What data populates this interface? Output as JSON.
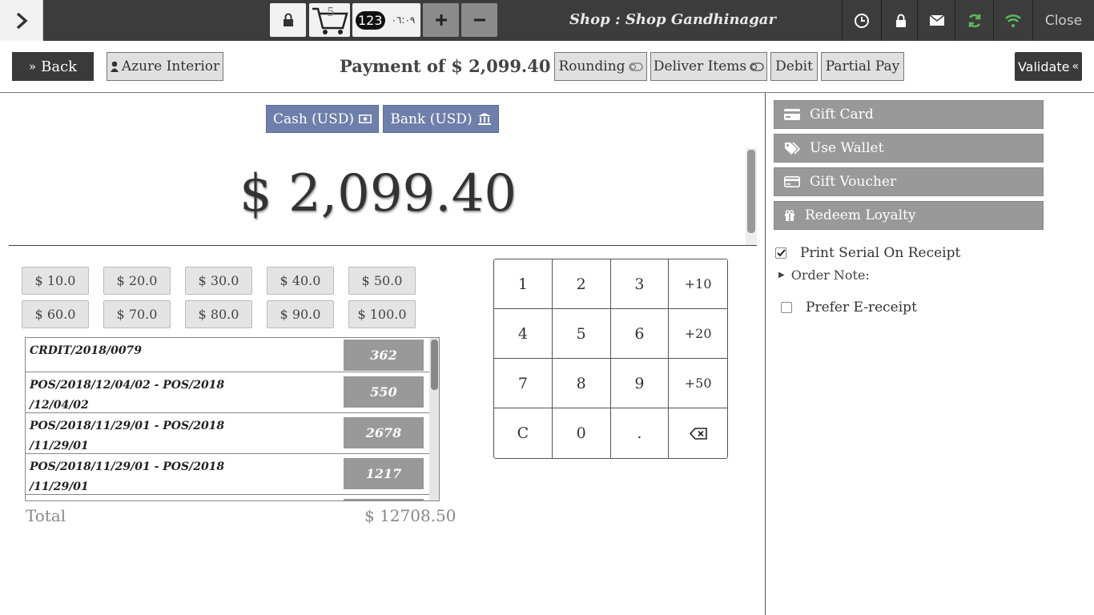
{
  "topbar": {
    "cart_count": "5",
    "numpad_badge": "123",
    "clock_text": "٠٦:٠٩",
    "shop_title": "Shop : Shop Gandhinagar",
    "close_label": "Close"
  },
  "header": {
    "back_label": "Back",
    "customer_label": "Azure Interior",
    "payment_title": "Payment of $ 2,099.40",
    "rounding_label": "Rounding",
    "deliver_label": "Deliver Items",
    "debit_label": "Debit",
    "partial_label": "Partial Pay",
    "validate_label": "Validate"
  },
  "payment_methods": [
    {
      "label": "Cash (USD)"
    },
    {
      "label": "Bank (USD)"
    }
  ],
  "amount_due": "$ 2,099.40",
  "quick_amounts": [
    "$ 10.0",
    "$ 20.0",
    "$ 30.0",
    "$ 40.0",
    "$ 50.0",
    "$ 60.0",
    "$ 70.0",
    "$ 80.0",
    "$ 90.0",
    "$ 100.0"
  ],
  "orders": [
    {
      "line1": "CRDIT/2018/0079",
      "line2": "",
      "amount": "362"
    },
    {
      "line1": "POS/2018/12/04/02 - POS/2018",
      "line2": "/12/04/02",
      "amount": "550"
    },
    {
      "line1": "POS/2018/11/29/01 - POS/2018",
      "line2": "/11/29/01",
      "amount": "2678"
    },
    {
      "line1": "POS/2018/11/29/01 - POS/2018",
      "line2": "/11/29/01",
      "amount": "1217"
    }
  ],
  "total": {
    "label": "Total",
    "value": "$ 12708.50"
  },
  "numpad": [
    "1",
    "2",
    "3",
    "+10",
    "4",
    "5",
    "6",
    "+20",
    "7",
    "8",
    "9",
    "+50",
    "C",
    "0",
    ".",
    "⌫"
  ],
  "right_panel": {
    "gift_card": "Gift Card",
    "use_wallet": "Use Wallet",
    "gift_voucher": "Gift Voucher",
    "redeem_loyalty": "Redeem Loyalty",
    "print_serial": "Print Serial On Receipt",
    "print_serial_checked": true,
    "order_note": "Order Note:",
    "prefer_ereceipt": "Prefer E-receipt",
    "prefer_ereceipt_checked": false
  },
  "colors": {
    "topbar_bg": "#3c3c3c",
    "payment_method_bg": "#6f7fab",
    "right_button_bg": "#999999",
    "status_green": "#5cb85c"
  }
}
